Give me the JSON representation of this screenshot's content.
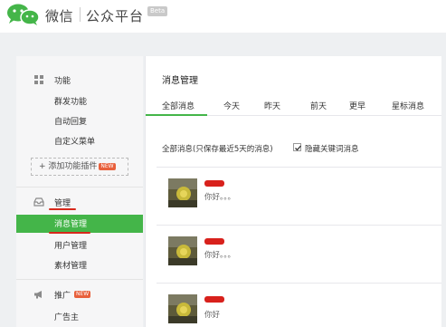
{
  "header": {
    "brand": "微信",
    "product": "公众平台",
    "beta_badge": "Beta"
  },
  "sidebar": {
    "groups": [
      {
        "title": "功能",
        "icon": "grid-icon",
        "items": [
          "群发功能",
          "自动回复",
          "自定义菜单"
        ]
      },
      {
        "add_plugin": "+ 添加功能插件",
        "add_plugin_badge": "NEW"
      },
      {
        "title": "管理",
        "icon": "inbox-icon",
        "items": [
          "消息管理",
          "用户管理",
          "素材管理"
        ],
        "active_item": "消息管理"
      },
      {
        "title": "推广",
        "title_badge": "NEW",
        "icon": "megaphone-icon",
        "items": [
          "广告主"
        ]
      }
    ]
  },
  "main": {
    "title": "消息管理",
    "tabs": [
      "全部消息",
      "今天",
      "昨天",
      "前天",
      "更早",
      "星标消息"
    ],
    "active_tab": "全部消息",
    "filter_text": "全部消息(只保存最近5天的消息)",
    "checkbox_label": "隐藏关键词消息",
    "checkbox_checked": true,
    "messages": [
      {
        "text": "你好。。。"
      },
      {
        "text": "你好。。。"
      },
      {
        "text": "你好"
      }
    ]
  },
  "colors": {
    "accent_green": "#44b549",
    "highlight_red": "#d7281b",
    "badge_orange": "#e8603c"
  }
}
